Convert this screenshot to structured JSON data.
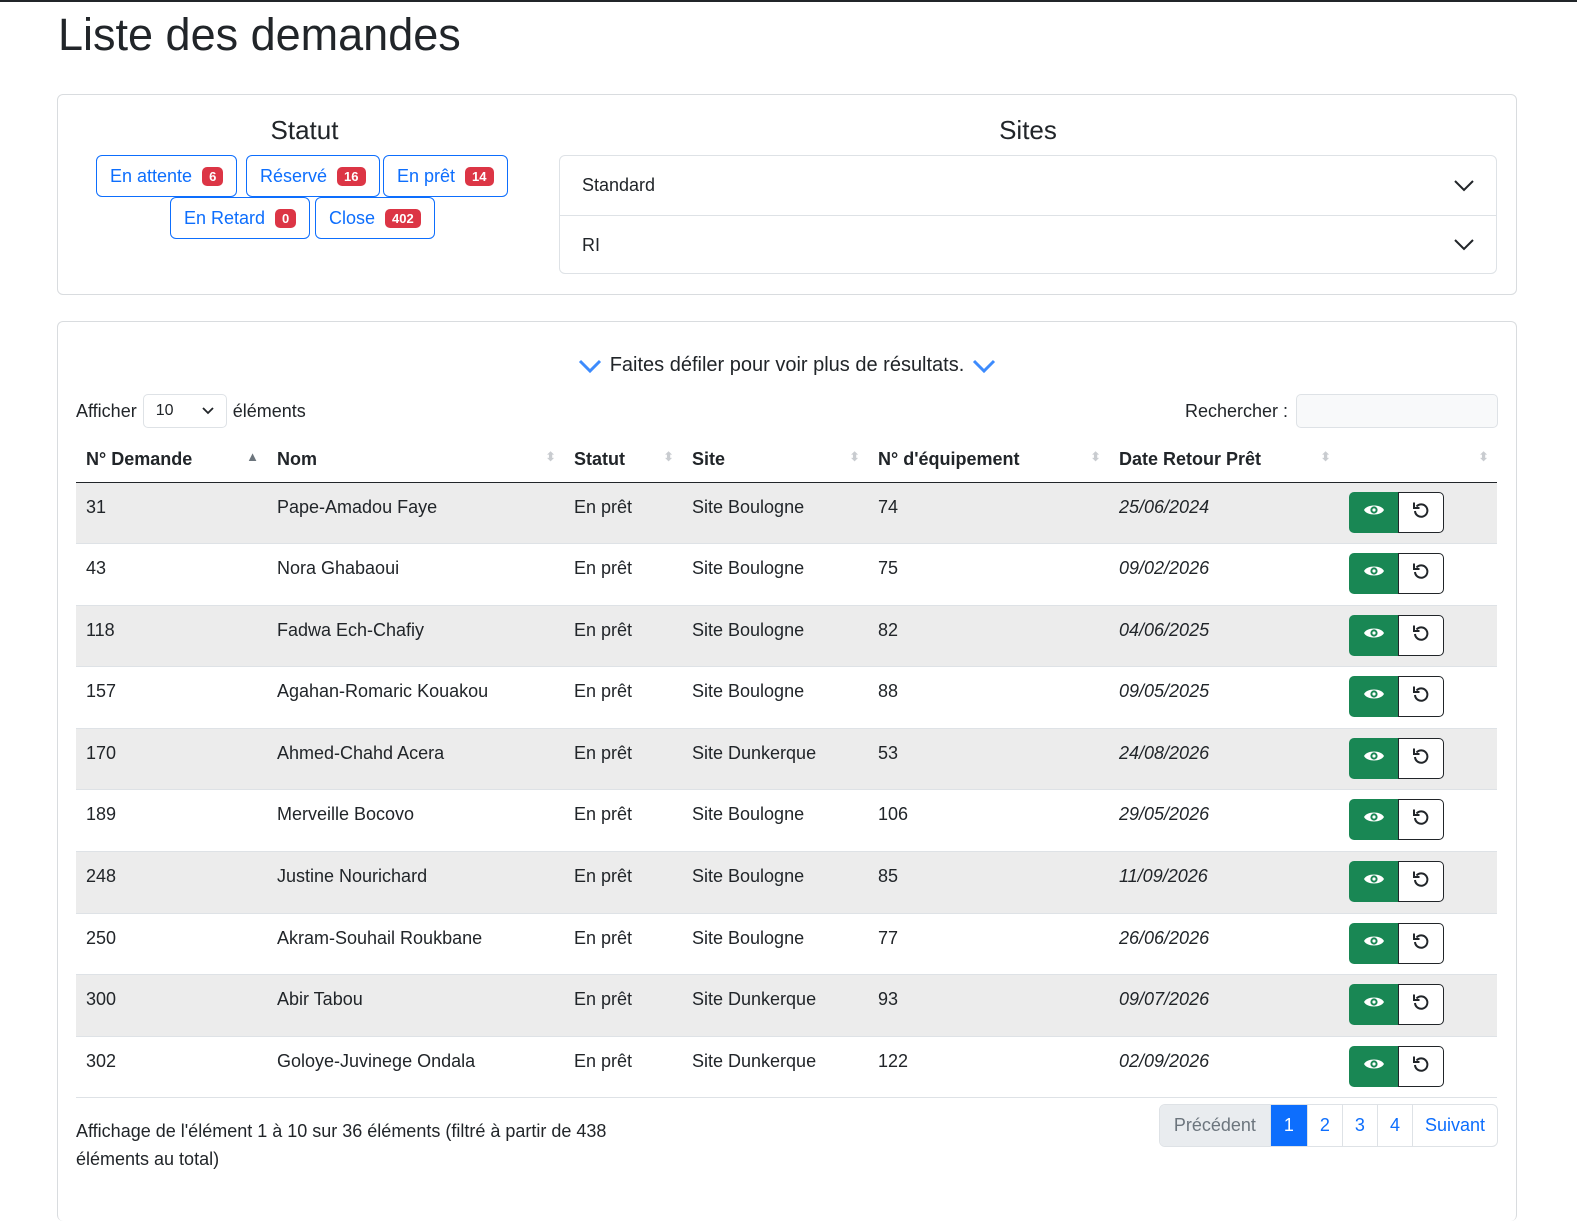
{
  "page": {
    "title": "Liste des demandes"
  },
  "filters": {
    "statut_title": "Statut",
    "sites_title": "Sites",
    "statuses": [
      {
        "label": "En attente",
        "count": "6"
      },
      {
        "label": "Réservé",
        "count": "16"
      },
      {
        "label": "En prêt",
        "count": "14"
      },
      {
        "label": "En Retard",
        "count": "0"
      },
      {
        "label": "Close",
        "count": "402"
      }
    ],
    "sites": [
      {
        "label": "Standard"
      },
      {
        "label": "RI"
      }
    ]
  },
  "table": {
    "scroll_hint": "Faites défiler pour voir plus de résultats.",
    "length": {
      "prefix": "Afficher",
      "value": "10",
      "suffix": "éléments"
    },
    "search_label": "Rechercher :",
    "columns": [
      "N° Demande",
      "Nom",
      "Statut",
      "Site",
      "N° d'équipement",
      "Date Retour Prêt",
      ""
    ],
    "rows": [
      {
        "id": "31",
        "nom": "Pape-Amadou Faye",
        "statut": "En prêt",
        "site": "Site Boulogne",
        "equip": "74",
        "date": "25/06/2024"
      },
      {
        "id": "43",
        "nom": "Nora Ghabaoui",
        "statut": "En prêt",
        "site": "Site Boulogne",
        "equip": "75",
        "date": "09/02/2026"
      },
      {
        "id": "118",
        "nom": "Fadwa Ech-Chafiy",
        "statut": "En prêt",
        "site": "Site Boulogne",
        "equip": "82",
        "date": "04/06/2025"
      },
      {
        "id": "157",
        "nom": "Agahan-Romaric Kouakou",
        "statut": "En prêt",
        "site": "Site Boulogne",
        "equip": "88",
        "date": "09/05/2025"
      },
      {
        "id": "170",
        "nom": "Ahmed-Chahd Acera",
        "statut": "En prêt",
        "site": "Site Dunkerque",
        "equip": "53",
        "date": "24/08/2026"
      },
      {
        "id": "189",
        "nom": "Merveille Bocovo",
        "statut": "En prêt",
        "site": "Site Boulogne",
        "equip": "106",
        "date": "29/05/2026"
      },
      {
        "id": "248",
        "nom": "Justine Nourichard",
        "statut": "En prêt",
        "site": "Site Boulogne",
        "equip": "85",
        "date": "11/09/2026"
      },
      {
        "id": "250",
        "nom": "Akram-Souhail Roukbane",
        "statut": "En prêt",
        "site": "Site Boulogne",
        "equip": "77",
        "date": "26/06/2026"
      },
      {
        "id": "300",
        "nom": "Abir Tabou",
        "statut": "En prêt",
        "site": "Site Dunkerque",
        "equip": "93",
        "date": "09/07/2026"
      },
      {
        "id": "302",
        "nom": "Goloye-Juvinege Ondala",
        "statut": "En prêt",
        "site": "Site Dunkerque",
        "equip": "122",
        "date": "02/09/2026"
      }
    ],
    "info": "Affichage de l'élément 1 à 10 sur 36 éléments (filtré à partir de 438 éléments au total)",
    "pagination": {
      "prev": "Précédent",
      "pages": [
        "1",
        "2",
        "3",
        "4"
      ],
      "current": "1",
      "next": "Suivant"
    }
  },
  "icons": {
    "view": "eye-icon",
    "reset": "undo-icon",
    "expand": "chevron-down-icon"
  },
  "colors": {
    "primary": "#0d6efd",
    "danger": "#dc3545",
    "success": "#198754"
  }
}
